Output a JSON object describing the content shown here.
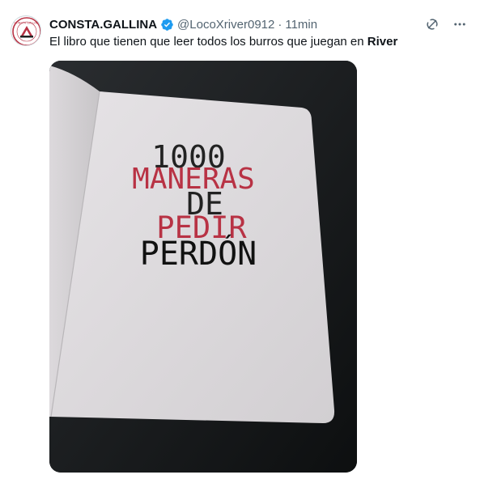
{
  "author": {
    "display_name": "CONSTA.GALLINA",
    "handle": "@LocoXriver0912",
    "separator": "·",
    "time": "11min",
    "verified": true,
    "avatar_label": "CONSTA GALLINA"
  },
  "tweet": {
    "text_prefix": "El libro que tienen que leer todos los burros que juegan en ",
    "text_bold": "River"
  },
  "media": {
    "book_lines": [
      {
        "text": "1000",
        "color": "#222222"
      },
      {
        "text": "MANERAS",
        "color": "#b83244"
      },
      {
        "text": "DE",
        "color": "#222222"
      },
      {
        "text": "PEDIR",
        "color": "#b83244"
      },
      {
        "text": "PERDÓN",
        "color": "#111111"
      }
    ]
  },
  "icons": {
    "grok": "grok-icon",
    "more": "more-icon",
    "verified": "verified-badge-icon"
  },
  "colors": {
    "verified_blue": "#1d9bf0",
    "secondary_text": "#536471",
    "primary_text": "#0f1419",
    "accent_red": "#b83244"
  }
}
